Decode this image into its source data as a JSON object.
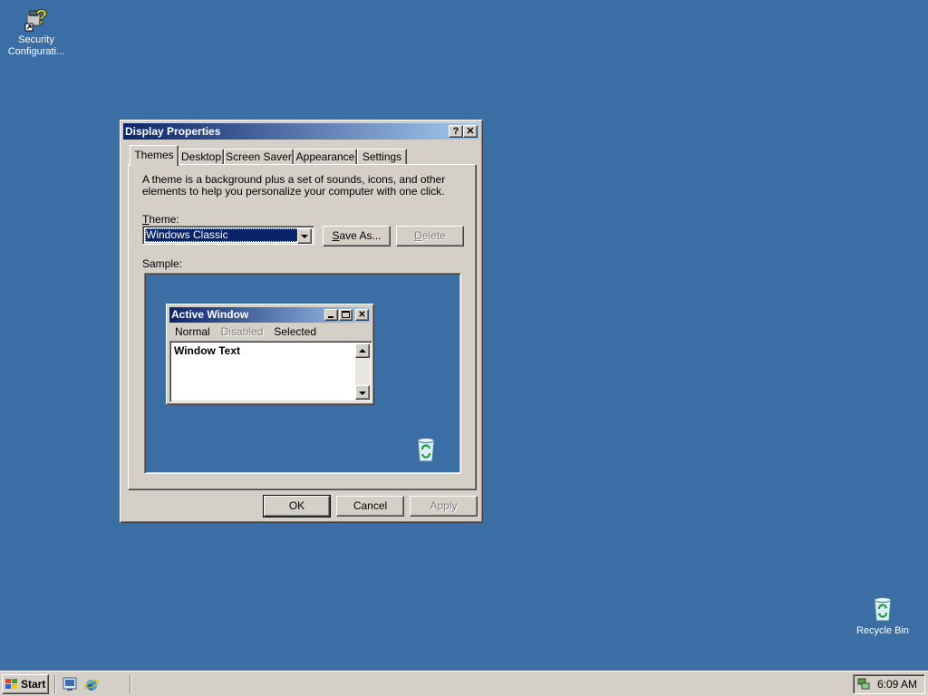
{
  "desktop": {
    "icons": [
      {
        "label_line1": "Security",
        "label_line2": "Configurati...",
        "icon": "security-configuration-icon"
      },
      {
        "label_line1": "Recycle Bin",
        "label_line2": "",
        "icon": "recycle-bin-icon"
      }
    ]
  },
  "dialog": {
    "title": "Display Properties",
    "help_btn": "?",
    "close_btn": "✕",
    "tabs": [
      {
        "label": "Themes",
        "active": true
      },
      {
        "label": "Desktop"
      },
      {
        "label": "Screen Saver"
      },
      {
        "label": "Appearance"
      },
      {
        "label": "Settings"
      }
    ],
    "themes": {
      "description": "A theme is a background plus a set of sounds, icons, and other elements to help you personalize your computer with one click.",
      "theme_label_accel": "T",
      "theme_label_rest": "heme:",
      "selected_theme": "Windows Classic",
      "save_as_accel": "S",
      "save_as_rest": "ave As...",
      "delete_accel": "D",
      "delete_rest": "elete",
      "sample_label": "Sample:"
    },
    "sample": {
      "window_title": "Active Window",
      "menu": {
        "normal": "Normal",
        "disabled": "Disabled",
        "selected": "Selected"
      },
      "window_text": "Window Text"
    },
    "buttons": {
      "ok": "OK",
      "cancel": "Cancel",
      "apply": "Apply"
    }
  },
  "taskbar": {
    "start_label": "Start",
    "quick_launch": [
      "show-desktop-icon",
      "internet-explorer-icon"
    ],
    "clock": "6:09 AM"
  },
  "colors": {
    "desktop": "#3a6ea5",
    "face": "#d4d0c8",
    "title_active_start": "#0a246a",
    "title_active_end": "#a6caf0"
  }
}
